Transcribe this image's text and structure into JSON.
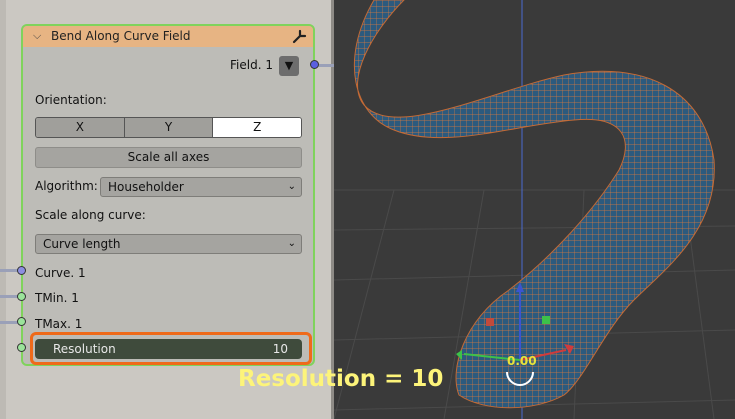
{
  "node": {
    "title": "Bend Along Curve Field",
    "output_label": "Field. 1",
    "orientation_label": "Orientation:",
    "axes": [
      "X",
      "Y",
      "Z"
    ],
    "selected_axis": "Z",
    "scale_all_axes_label": "Scale all axes",
    "algorithm_label": "Algorithm:",
    "algorithm_value": "Householder",
    "scale_along_label": "Scale along curve:",
    "scale_along_value": "Curve length",
    "inputs": [
      "Curve. 1",
      "TMin. 1",
      "TMax. 1"
    ],
    "resolution_label": "Resolution",
    "resolution_value": "10"
  },
  "viewport": {
    "gizmo_value": "0.00",
    "caption": "Resolution = 10"
  },
  "colors": {
    "header": "#e7b483",
    "node_border": "#7fd35c",
    "highlight": "#ef6a1a",
    "caption": "#fdf47a",
    "mesh_fill": "#2c5a7e",
    "mesh_wire": "#e07a3a"
  },
  "icons": [
    "collapse-chevron-icon",
    "wrench-icon",
    "dropdown-arrow-icon"
  ]
}
